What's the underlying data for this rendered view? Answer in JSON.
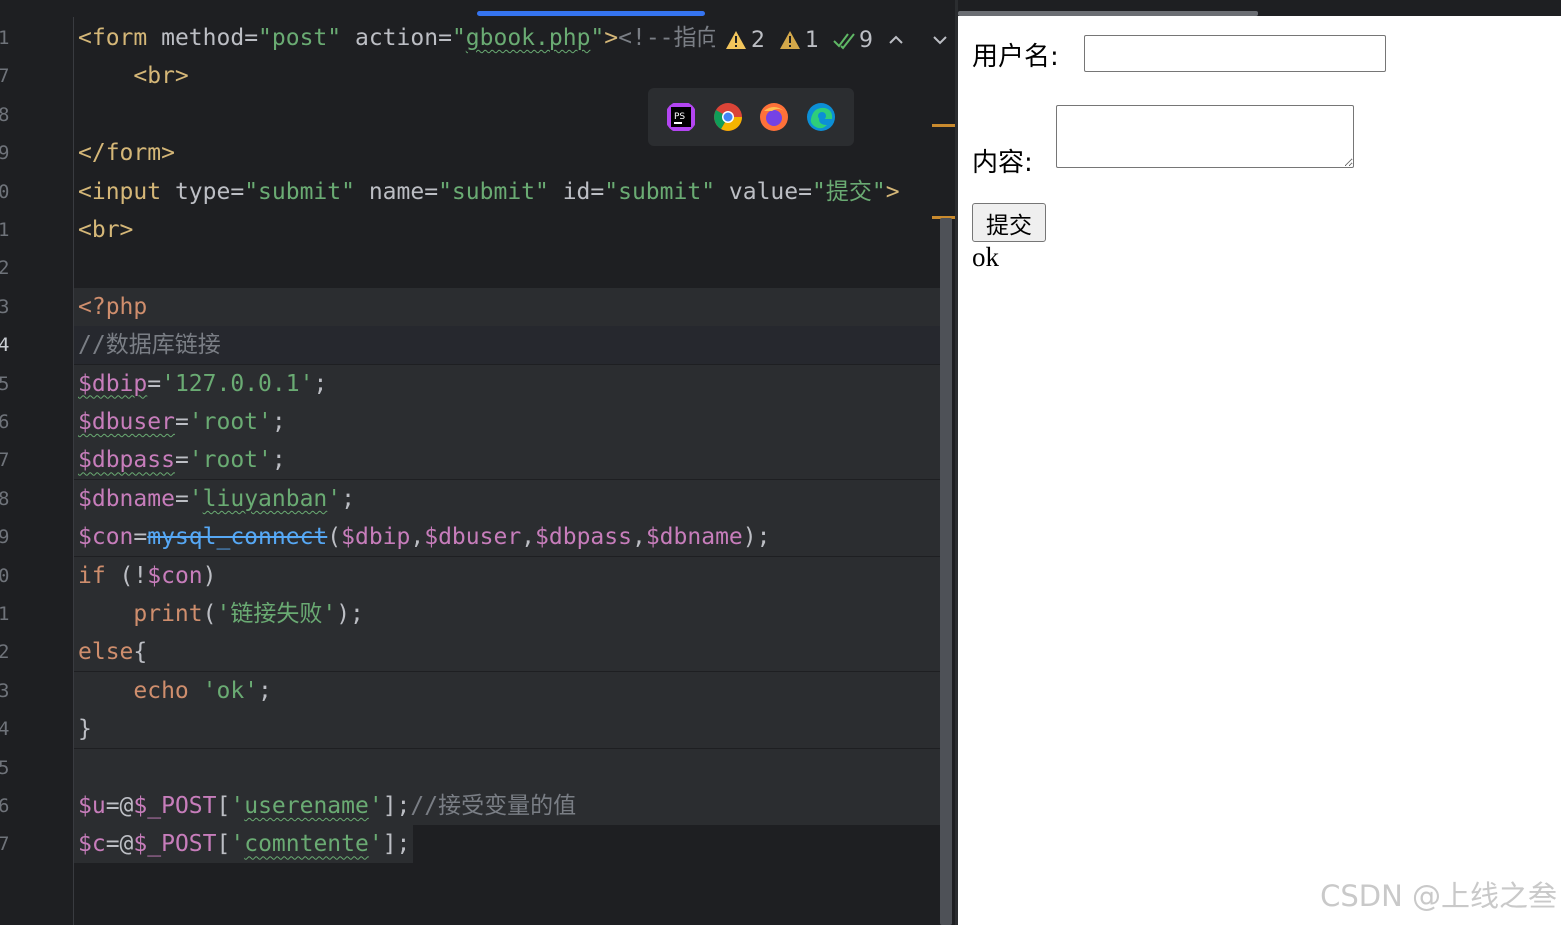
{
  "editor": {
    "line_numbers": [
      "1",
      "7",
      "8",
      "9",
      "0",
      "1",
      "2",
      "3",
      "4",
      "5",
      "6",
      "7",
      "8",
      "9",
      "0",
      "1",
      "2",
      "3",
      "4",
      "5",
      "6",
      "7"
    ],
    "active_line_index": 8,
    "lines": [
      [
        {
          "t": "<form ",
          "c": "tag"
        },
        {
          "t": "method",
          "c": "attr"
        },
        {
          "t": "=",
          "c": "punc"
        },
        {
          "t": "\"post\"",
          "c": "str"
        },
        {
          "t": " action",
          "c": "attr"
        },
        {
          "t": "=",
          "c": "punc"
        },
        {
          "t": "\"",
          "c": "str"
        },
        {
          "t": "gbook.php",
          "c": "str squig"
        },
        {
          "t": "\"",
          "c": "str"
        },
        {
          "t": ">",
          "c": "tag"
        },
        {
          "t": "<!--指向",
          "c": "cmt"
        }
      ],
      [
        {
          "t": "    <br>",
          "c": "tag"
        }
      ],
      [],
      [
        {
          "t": "</form>",
          "c": "tag"
        }
      ],
      [
        {
          "t": "<input ",
          "c": "tag"
        },
        {
          "t": "type",
          "c": "attr"
        },
        {
          "t": "=",
          "c": "punc"
        },
        {
          "t": "\"submit\"",
          "c": "str"
        },
        {
          "t": " name",
          "c": "attr"
        },
        {
          "t": "=",
          "c": "punc"
        },
        {
          "t": "\"submit\"",
          "c": "str"
        },
        {
          "t": " id",
          "c": "attr"
        },
        {
          "t": "=",
          "c": "punc"
        },
        {
          "t": "\"submit\"",
          "c": "str"
        },
        {
          "t": " value",
          "c": "attr"
        },
        {
          "t": "=",
          "c": "punc"
        },
        {
          "t": "\"提交\"",
          "c": "str"
        },
        {
          "t": ">",
          "c": "tag"
        }
      ],
      [
        {
          "t": "<br>",
          "c": "tag"
        }
      ],
      [],
      [
        {
          "t": "<?php",
          "c": "kw"
        }
      ],
      [
        {
          "t": "//数据库链接",
          "c": "cmt"
        }
      ],
      [
        {
          "t": "$dbip",
          "c": "var squig"
        },
        {
          "t": "=",
          "c": "punc"
        },
        {
          "t": "'127.0.0.1'",
          "c": "str"
        },
        {
          "t": ";",
          "c": "punc"
        }
      ],
      [
        {
          "t": "$dbuser",
          "c": "var squig"
        },
        {
          "t": "=",
          "c": "punc"
        },
        {
          "t": "'root'",
          "c": "str"
        },
        {
          "t": ";",
          "c": "punc"
        }
      ],
      [
        {
          "t": "$dbpass",
          "c": "var squig"
        },
        {
          "t": "=",
          "c": "punc"
        },
        {
          "t": "'root'",
          "c": "str"
        },
        {
          "t": ";",
          "c": "punc"
        }
      ],
      [
        {
          "t": "$dbname",
          "c": "var"
        },
        {
          "t": "=",
          "c": "punc"
        },
        {
          "t": "'",
          "c": "str"
        },
        {
          "t": "liuyanban",
          "c": "str squig"
        },
        {
          "t": "'",
          "c": "str"
        },
        {
          "t": ";",
          "c": "punc"
        }
      ],
      [
        {
          "t": "$con",
          "c": "var"
        },
        {
          "t": "=",
          "c": "punc"
        },
        {
          "t": "mysql_connect",
          "c": "fn strike"
        },
        {
          "t": "(",
          "c": "punc"
        },
        {
          "t": "$dbip",
          "c": "var"
        },
        {
          "t": ",",
          "c": "punc"
        },
        {
          "t": "$dbuser",
          "c": "var"
        },
        {
          "t": ",",
          "c": "punc"
        },
        {
          "t": "$dbpass",
          "c": "var"
        },
        {
          "t": ",",
          "c": "punc"
        },
        {
          "t": "$dbname",
          "c": "var"
        },
        {
          "t": ");",
          "c": "punc"
        }
      ],
      [
        {
          "t": "if",
          "c": "kw"
        },
        {
          "t": " (!",
          "c": "punc"
        },
        {
          "t": "$con",
          "c": "var"
        },
        {
          "t": ")",
          "c": "punc"
        }
      ],
      [
        {
          "t": "    print",
          "c": "kw"
        },
        {
          "t": "(",
          "c": "punc"
        },
        {
          "t": "'链接失败'",
          "c": "str"
        },
        {
          "t": ");",
          "c": "punc"
        }
      ],
      [
        {
          "t": "else",
          "c": "kw"
        },
        {
          "t": "{",
          "c": "punc"
        }
      ],
      [
        {
          "t": "    echo",
          "c": "kw"
        },
        {
          "t": " ",
          "c": "punc"
        },
        {
          "t": "'ok'",
          "c": "str"
        },
        {
          "t": ";",
          "c": "punc"
        }
      ],
      [
        {
          "t": "}",
          "c": "punc"
        }
      ],
      [],
      [
        {
          "t": "$u",
          "c": "var"
        },
        {
          "t": "=@",
          "c": "punc"
        },
        {
          "t": "$_POST",
          "c": "var"
        },
        {
          "t": "[",
          "c": "punc"
        },
        {
          "t": "'",
          "c": "str"
        },
        {
          "t": "userename",
          "c": "str squig"
        },
        {
          "t": "'",
          "c": "str"
        },
        {
          "t": "];",
          "c": "punc"
        },
        {
          "t": "//接受变量的值",
          "c": "cmt"
        }
      ],
      [
        {
          "t": "$c",
          "c": "var"
        },
        {
          "t": "=@",
          "c": "punc"
        },
        {
          "t": "$_POST",
          "c": "var"
        },
        {
          "t": "[",
          "c": "punc"
        },
        {
          "t": "'",
          "c": "str"
        },
        {
          "t": "comntente",
          "c": "str squig"
        },
        {
          "t": "'",
          "c": "str"
        },
        {
          "t": "];",
          "c": "punc"
        }
      ]
    ],
    "inspections": {
      "warnings_strong": "2",
      "warnings_weak": "1",
      "ok": "9"
    },
    "browser_icons": [
      "phpstorm-icon",
      "chrome-icon",
      "firefox-icon",
      "edge-icon"
    ]
  },
  "browser": {
    "username_label": "用户名:",
    "content_label": "内容:",
    "submit_label": "提交",
    "output_text": "ok",
    "watermark": "CSDN @上线之叁"
  }
}
